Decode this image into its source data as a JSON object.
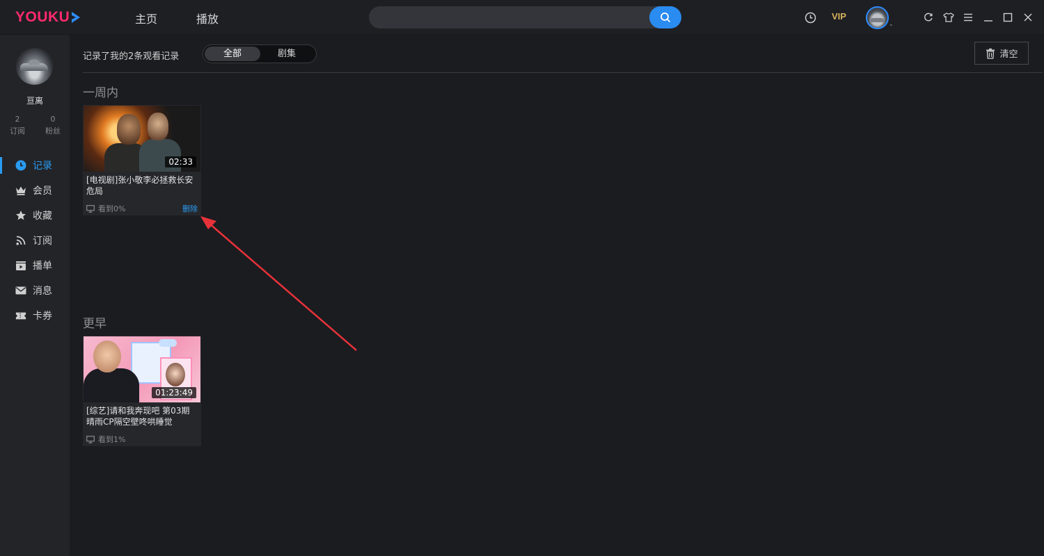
{
  "app": {
    "logo_text": "YOUKU",
    "brand_color": "#ff2a6d",
    "accent_color": "#2a9bf2"
  },
  "topnav": {
    "items": [
      {
        "label": "主页"
      },
      {
        "label": "播放"
      }
    ],
    "search": {
      "placeholder": "",
      "icon": "search-icon"
    },
    "vip_label": "VIP",
    "icons": [
      "history-icon",
      "refresh-icon",
      "skin-icon",
      "menu-icon",
      "minimize-icon",
      "maximize-icon",
      "close-icon"
    ]
  },
  "sidebar": {
    "username": "亘离",
    "stats": [
      {
        "value": "2",
        "label": "订阅"
      },
      {
        "value": "0",
        "label": "粉丝"
      }
    ],
    "items": [
      {
        "label": "记录",
        "icon": "clock-icon",
        "active": true
      },
      {
        "label": "会员",
        "icon": "crown-icon"
      },
      {
        "label": "收藏",
        "icon": "star-icon"
      },
      {
        "label": "订阅",
        "icon": "rss-icon"
      },
      {
        "label": "播单",
        "icon": "playlist-icon"
      },
      {
        "label": "消息",
        "icon": "mail-icon"
      },
      {
        "label": "卡券",
        "icon": "ticket-icon"
      }
    ]
  },
  "history": {
    "summary": "记录了我的2条观看记录",
    "filters": [
      {
        "label": "全部",
        "selected": true
      },
      {
        "label": "剧集",
        "selected": false
      }
    ],
    "clear_label": "清空",
    "sections": [
      {
        "title": "一周内",
        "items": [
          {
            "title": "[电视剧]张小敬李必拯救长安危局",
            "duration": "02:33",
            "progress": "看到0%",
            "delete_label": "删除"
          }
        ]
      },
      {
        "title": "更早",
        "items": [
          {
            "title": "[综艺]请和我奔现吧 第03期 晴雨CP隔空壁咚哄睡觉",
            "duration": "01:23:49",
            "progress": "看到1%"
          }
        ]
      }
    ]
  }
}
